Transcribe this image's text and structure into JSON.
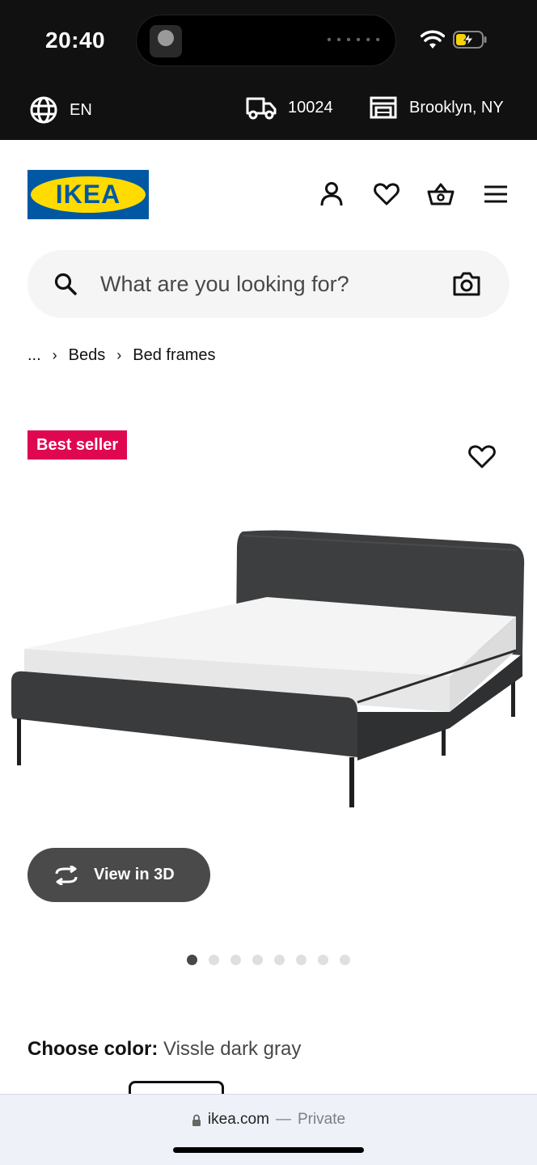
{
  "status_bar": {
    "time": "20:40"
  },
  "top_bar": {
    "language": "EN",
    "zip": "10024",
    "store": "Brooklyn, NY"
  },
  "header": {
    "logo_text": "IKEA"
  },
  "search": {
    "placeholder": "What are you looking for?"
  },
  "breadcrumb": {
    "ellipsis": "...",
    "items": [
      "Beds",
      "Bed frames"
    ]
  },
  "product": {
    "badge": "Best seller",
    "view_3d_label": "View in 3D",
    "image_count": 8,
    "active_image_index": 0,
    "choose_color_label": "Choose color:",
    "color_value": "Vissle dark gray"
  },
  "browser": {
    "domain": "ikea.com",
    "separator": "—",
    "mode": "Private"
  },
  "colors": {
    "badge": "#e00751",
    "logo_blue": "#0058a3",
    "logo_yellow": "#ffdb00",
    "top_bar_bg": "#111111",
    "search_bg": "#f5f5f5"
  }
}
